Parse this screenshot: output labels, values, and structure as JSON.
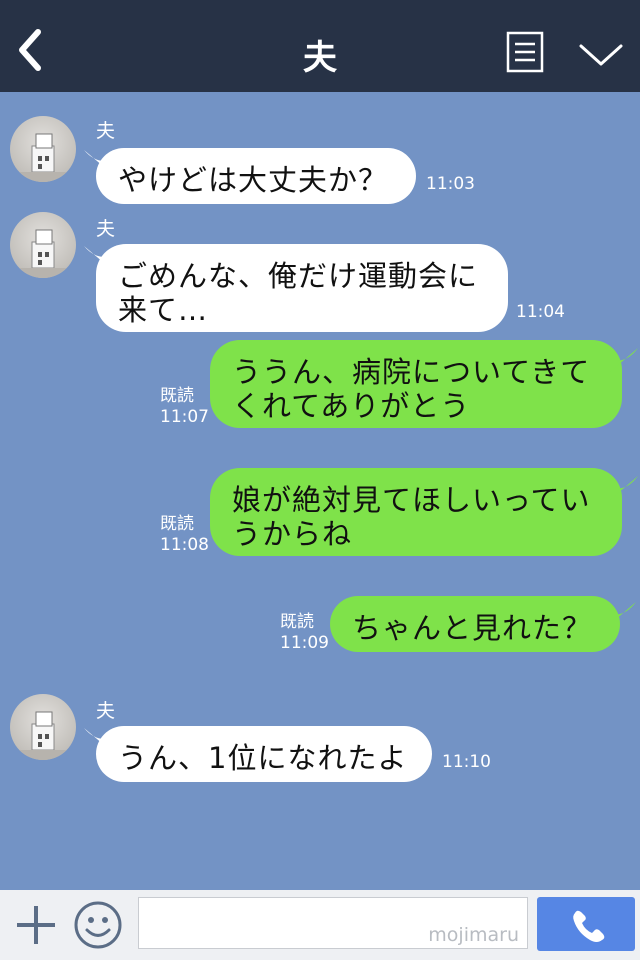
{
  "header": {
    "title": "夫"
  },
  "messages": [
    {
      "sender": "夫",
      "text": "やけどは大丈夫か？",
      "time": "11:03"
    },
    {
      "sender": "夫",
      "line1": "ごめんな、俺だけ運動会に",
      "line2": "来て…",
      "time": "11:04"
    },
    {
      "read": "既読",
      "line1": "ううん、病院についてきて",
      "line2": "くれてありがとう",
      "time": "11:07"
    },
    {
      "read": "既読",
      "line1": "娘が絶対見てほしいってい",
      "line2": "うからね",
      "time": "11:08"
    },
    {
      "read": "既読",
      "text": "ちゃんと見れた？",
      "time": "11:09"
    },
    {
      "sender": "夫",
      "text": "うん、1位になれたよ",
      "time": "11:10"
    }
  ],
  "footer": {
    "watermark": "mojimaru"
  },
  "colors": {
    "header": "#273246",
    "background": "#7393c5",
    "outgoing": "#7fe24a",
    "incoming": "#ffffff",
    "call": "#5686e4"
  }
}
